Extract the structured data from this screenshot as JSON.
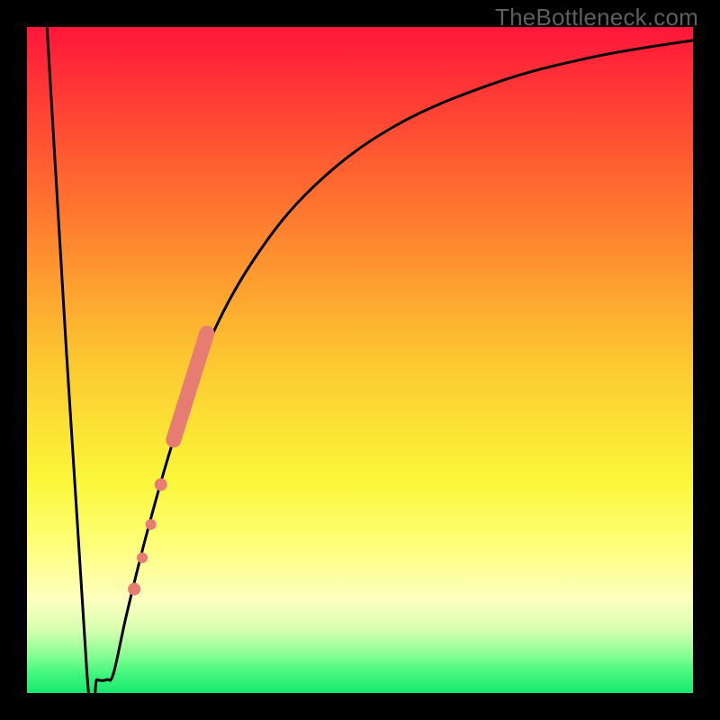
{
  "watermark": "TheBottleneck.com",
  "chart_data": {
    "type": "line",
    "title": "",
    "xlabel": "",
    "ylabel": "",
    "xlim": [
      0,
      100
    ],
    "ylim": [
      0,
      100
    ],
    "background_gradient": {
      "stops": [
        {
          "offset": 0.0,
          "color": "#ff163a"
        },
        {
          "offset": 0.25,
          "color": "#ff6e2f"
        },
        {
          "offset": 0.5,
          "color": "#fcc730"
        },
        {
          "offset": 0.68,
          "color": "#fbf738"
        },
        {
          "offset": 0.78,
          "color": "#feff7c"
        },
        {
          "offset": 0.86,
          "color": "#fdffbf"
        },
        {
          "offset": 0.905,
          "color": "#d7ffb0"
        },
        {
          "offset": 0.94,
          "color": "#8fff95"
        },
        {
          "offset": 0.97,
          "color": "#44f77e"
        },
        {
          "offset": 1.0,
          "color": "#17e86e"
        }
      ]
    },
    "series": [
      {
        "name": "bottleneck-curve",
        "stroke": "#000000",
        "points": [
          {
            "x": 3.0,
            "y": 100.0
          },
          {
            "x": 9.0,
            "y": 3.0
          },
          {
            "x": 10.5,
            "y": 2.0
          },
          {
            "x": 12.0,
            "y": 2.0
          },
          {
            "x": 13.0,
            "y": 3.0
          },
          {
            "x": 15.0,
            "y": 12.0
          },
          {
            "x": 18.0,
            "y": 24.0
          },
          {
            "x": 22.0,
            "y": 38.0
          },
          {
            "x": 27.0,
            "y": 52.0
          },
          {
            "x": 34.0,
            "y": 65.0
          },
          {
            "x": 43.0,
            "y": 76.0
          },
          {
            "x": 55.0,
            "y": 85.0
          },
          {
            "x": 70.0,
            "y": 91.5
          },
          {
            "x": 85.0,
            "y": 95.5
          },
          {
            "x": 100.0,
            "y": 98.0
          }
        ]
      }
    ],
    "markers": {
      "color": "#e77c73",
      "thick_segment": {
        "x1": 22.0,
        "y1": 38.0,
        "x2": 27.0,
        "y2": 54.0
      },
      "dots": [
        {
          "x": 20.1,
          "y": 31.3,
          "r": 7
        },
        {
          "x": 18.6,
          "y": 25.3,
          "r": 6
        },
        {
          "x": 17.3,
          "y": 20.3,
          "r": 6
        },
        {
          "x": 16.1,
          "y": 15.6,
          "r": 7
        }
      ]
    }
  }
}
